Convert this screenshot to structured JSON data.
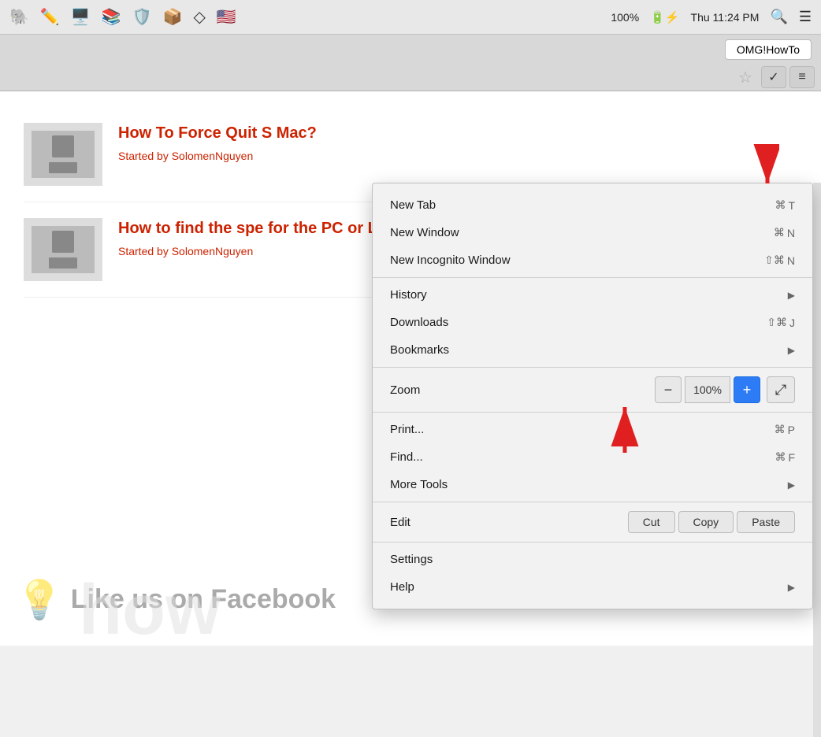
{
  "menubar": {
    "icons": [
      "🐘",
      "✏️",
      "🖥️",
      "📚",
      "🛡️",
      "📦",
      "💎",
      "🇺🇸"
    ],
    "battery": "100%",
    "battery_icon": "⚡",
    "time": "Thu 11:24 PM",
    "search_icon": "🔍",
    "menu_icon": "☰"
  },
  "browser": {
    "omg_button": "OMG!HowTo",
    "star_icon": "★",
    "extensions_icon": "✓",
    "menu_icon": "≡"
  },
  "articles": [
    {
      "title": "How To Force Quit S Mac?",
      "author": "Started by",
      "author_name": "SolomenNguyen"
    },
    {
      "title": "How to find the spe for the PC or Lapto...",
      "author": "Started by",
      "author_name": "SolomenNguyen"
    }
  ],
  "page_bottom": {
    "like_text": "Like us on Facebook",
    "how_text": "how"
  },
  "menu": {
    "sections": [
      {
        "items": [
          {
            "label": "New Tab",
            "shortcut": "⌘T",
            "has_arrow": false
          },
          {
            "label": "New Window",
            "shortcut": "⌘N",
            "has_arrow": false
          },
          {
            "label": "New Incognito Window",
            "shortcut": "⇧⌘N",
            "has_arrow": false
          }
        ]
      },
      {
        "items": [
          {
            "label": "History",
            "shortcut": "",
            "has_arrow": true
          },
          {
            "label": "Downloads",
            "shortcut": "⇧⌘J",
            "has_arrow": false
          },
          {
            "label": "Bookmarks",
            "shortcut": "",
            "has_arrow": true
          }
        ]
      },
      {
        "zoom_label": "Zoom",
        "zoom_minus": "−",
        "zoom_value": "100%",
        "zoom_plus": "+",
        "zoom_fullscreen": "⤢"
      },
      {
        "items": [
          {
            "label": "Print...",
            "shortcut": "⌘P",
            "has_arrow": false
          },
          {
            "label": "Find...",
            "shortcut": "⌘F",
            "has_arrow": false
          },
          {
            "label": "More Tools",
            "shortcut": "",
            "has_arrow": true
          }
        ]
      },
      {
        "edit_label": "Edit",
        "edit_buttons": [
          "Cut",
          "Copy",
          "Paste"
        ]
      },
      {
        "items": [
          {
            "label": "Settings",
            "shortcut": "",
            "has_arrow": false
          },
          {
            "label": "Help",
            "shortcut": "",
            "has_arrow": true
          }
        ]
      }
    ]
  }
}
